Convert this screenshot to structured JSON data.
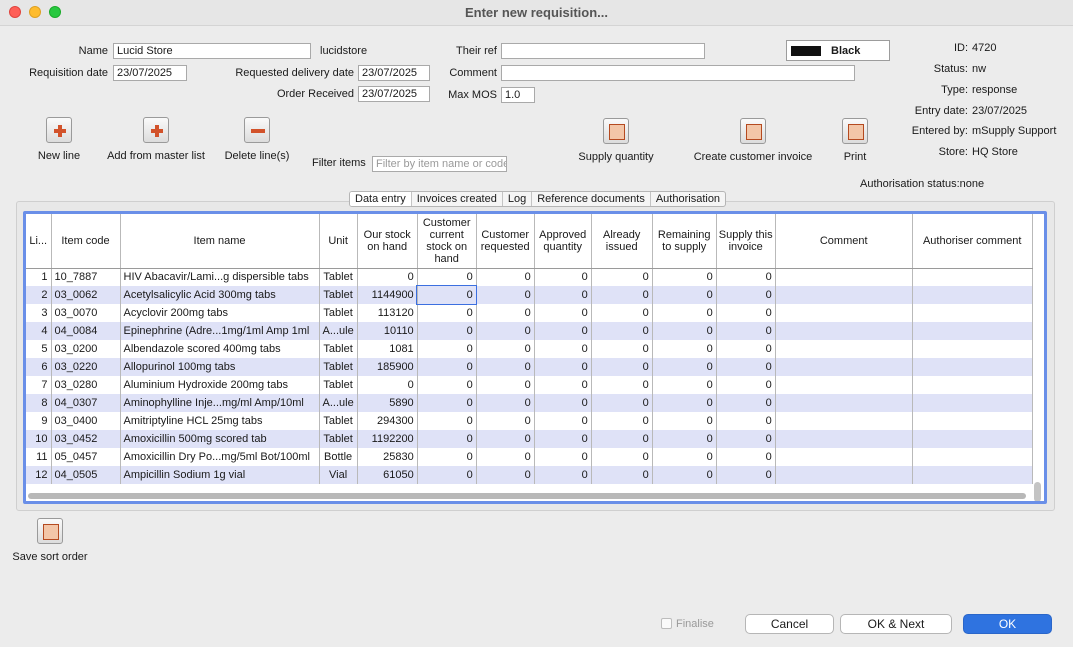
{
  "window": {
    "title": "Enter new requisition..."
  },
  "form": {
    "name_label": "Name",
    "name_value": "Lucid Store",
    "name_code": "lucidstore",
    "their_ref_label": "Their ref",
    "their_ref_value": "",
    "color_name": "Black",
    "req_date_label": "Requisition date",
    "req_date_value": "23/07/2025",
    "req_delivery_label": "Requested delivery date",
    "req_delivery_value": "23/07/2025",
    "comment_label": "Comment",
    "comment_value": "",
    "order_received_label": "Order Received",
    "order_received_value": "23/07/2025",
    "max_mos_label": "Max MOS",
    "max_mos_value": "1.0",
    "filter_label": "Filter items",
    "filter_placeholder": "Filter by item name or code"
  },
  "info": {
    "id_label": "ID:",
    "id_value": "4720",
    "status_label": "Status:",
    "status_value": "nw",
    "type_label": "Type:",
    "type_value": "response",
    "entry_label": "Entry date:",
    "entry_value": "23/07/2025",
    "entered_label": "Entered by:",
    "entered_value": "mSupply Support",
    "store_label": "Store:",
    "store_value": "HQ Store",
    "auth_status": "Authorisation status:none"
  },
  "toolbar": {
    "new_line": "New line",
    "add_master": "Add from master list",
    "delete_lines": "Delete line(s)",
    "supply_qty": "Supply quantity",
    "create_invoice": "Create customer invoice",
    "print": "Print"
  },
  "tabs": [
    "Data entry",
    "Invoices created",
    "Log",
    "Reference documents",
    "Authorisation"
  ],
  "table": {
    "headers": [
      "Li...",
      "Item code",
      "Item name",
      "Unit",
      "Our stock on hand",
      "Customer current stock on hand",
      "Customer requested",
      "Approved quantity",
      "Already issued",
      "Remaining to supply",
      "Supply this invoice",
      "Comment",
      "Authoriser comment"
    ],
    "rows": [
      [
        "1",
        "10_7887",
        "HIV Abacavir/Lami...g dispersible tabs",
        "Tablet",
        "0",
        "0",
        "0",
        "0",
        "0",
        "0",
        "0",
        "",
        ""
      ],
      [
        "2",
        "03_0062",
        "Acetylsalicylic Acid 300mg tabs",
        "Tablet",
        "1144900",
        "0",
        "0",
        "0",
        "0",
        "0",
        "0",
        "",
        ""
      ],
      [
        "3",
        "03_0070",
        "Acyclovir 200mg tabs",
        "Tablet",
        "113120",
        "0",
        "0",
        "0",
        "0",
        "0",
        "0",
        "",
        ""
      ],
      [
        "4",
        "04_0084",
        "Epinephrine (Adre...1mg/1ml Amp 1ml",
        "A...ule",
        "10110",
        "0",
        "0",
        "0",
        "0",
        "0",
        "0",
        "",
        ""
      ],
      [
        "5",
        "03_0200",
        "Albendazole scored 400mg tabs",
        "Tablet",
        "1081",
        "0",
        "0",
        "0",
        "0",
        "0",
        "0",
        "",
        ""
      ],
      [
        "6",
        "03_0220",
        "Allopurinol 100mg tabs",
        "Tablet",
        "185900",
        "0",
        "0",
        "0",
        "0",
        "0",
        "0",
        "",
        ""
      ],
      [
        "7",
        "03_0280",
        "Aluminium Hydroxide 200mg tabs",
        "Tablet",
        "0",
        "0",
        "0",
        "0",
        "0",
        "0",
        "0",
        "",
        ""
      ],
      [
        "8",
        "04_0307",
        "Aminophylline Inje...mg/ml Amp/10ml",
        "A...ule",
        "5890",
        "0",
        "0",
        "0",
        "0",
        "0",
        "0",
        "",
        ""
      ],
      [
        "9",
        "03_0400",
        "Amitriptyline HCL 25mg tabs",
        "Tablet",
        "294300",
        "0",
        "0",
        "0",
        "0",
        "0",
        "0",
        "",
        ""
      ],
      [
        "10",
        "03_0452",
        "Amoxicillin 500mg scored tab",
        "Tablet",
        "1192200",
        "0",
        "0",
        "0",
        "0",
        "0",
        "0",
        "",
        ""
      ],
      [
        "11",
        "05_0457",
        "Amoxicillin Dry Po...mg/5ml Bot/100ml",
        "Bottle",
        "25830",
        "0",
        "0",
        "0",
        "0",
        "0",
        "0",
        "",
        ""
      ],
      [
        "12",
        "04_0505",
        "Ampicillin Sodium 1g vial",
        "Vial",
        "61050",
        "0",
        "0",
        "0",
        "0",
        "0",
        "0",
        "",
        ""
      ]
    ]
  },
  "footer": {
    "save_sort": "Save sort order",
    "finalise": "Finalise",
    "cancel": "Cancel",
    "ok_next": "OK & Next",
    "ok": "OK"
  }
}
